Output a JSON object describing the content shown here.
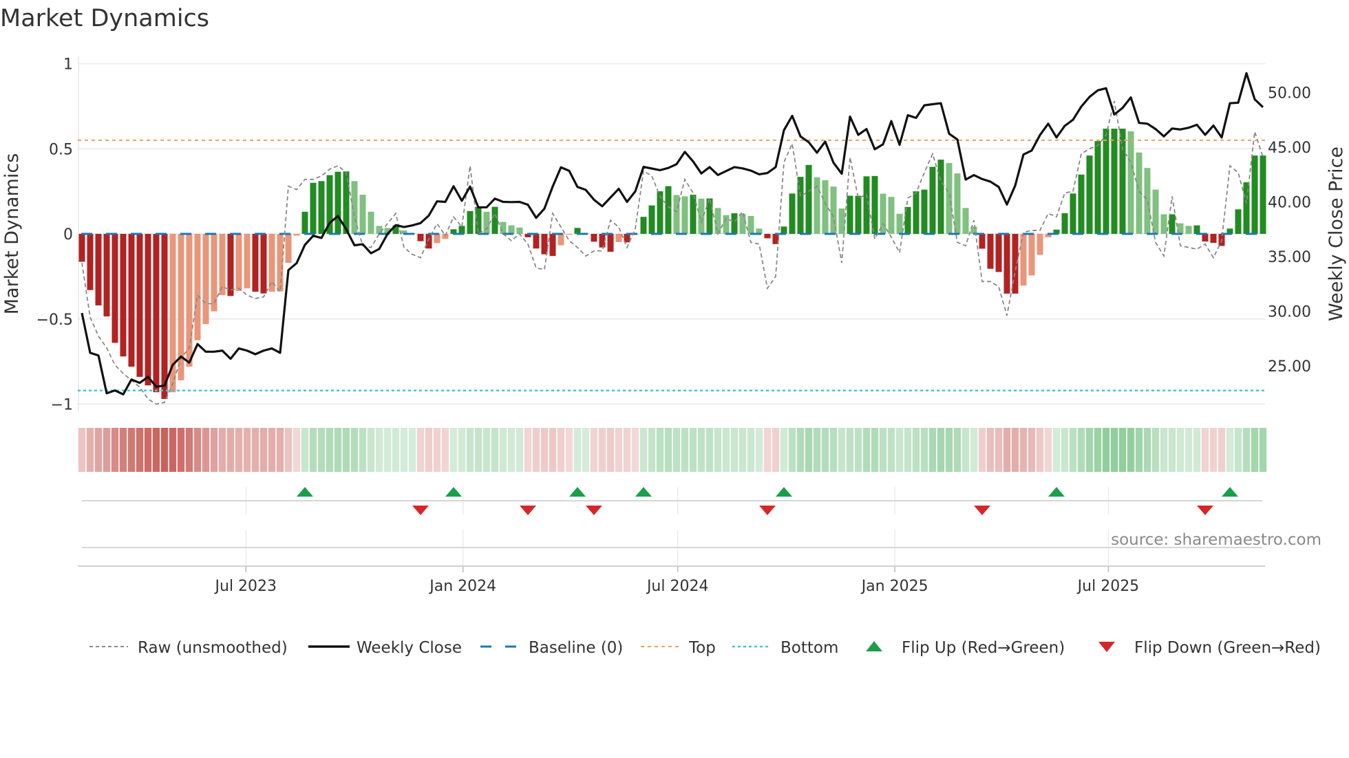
{
  "chart_data": {
    "type": "bar",
    "title": "Market Dynamics",
    "ylabel": "Market Dynamics",
    "y2label": "Weekly Close Price",
    "ylim": [
      -1.02,
      1.02
    ],
    "y2lim": [
      21.5,
      53.5
    ],
    "yticks": [
      {
        "v": 1,
        "label": "1"
      },
      {
        "v": 0.5,
        "label": "0.5"
      },
      {
        "v": 0,
        "label": "0"
      },
      {
        "v": -0.5,
        "label": "−0.5"
      },
      {
        "v": -1,
        "label": "−1"
      }
    ],
    "y2ticks": [
      {
        "v": 50,
        "label": "50.00"
      },
      {
        "v": 45,
        "label": "45.00"
      },
      {
        "v": 40,
        "label": "40.00"
      },
      {
        "v": 35,
        "label": "35.00"
      },
      {
        "v": 30,
        "label": "30.00"
      },
      {
        "v": 25,
        "label": "25.00"
      }
    ],
    "x_start": "2023-02-12",
    "x_step_days": 7,
    "xticks": [
      {
        "date": "2023-07-01",
        "label": "Jul 2023"
      },
      {
        "date": "2024-01-01",
        "label": "Jan 2024"
      },
      {
        "date": "2024-07-01",
        "label": "Jul 2024"
      },
      {
        "date": "2025-01-01",
        "label": "Jan 2025"
      },
      {
        "date": "2025-07-01",
        "label": "Jul 2025"
      }
    ],
    "top_level": 0.55,
    "bottom_level": -0.92,
    "baseline": 0,
    "momentum": [
      -0.164,
      -0.33,
      -0.42,
      -0.485,
      -0.64,
      -0.72,
      -0.78,
      -0.84,
      -0.89,
      -0.93,
      -0.97,
      -0.93,
      -0.86,
      -0.78,
      -0.625,
      -0.53,
      -0.455,
      -0.36,
      -0.365,
      -0.335,
      -0.32,
      -0.34,
      -0.35,
      -0.34,
      -0.338,
      -0.17,
      -0.01,
      0.13,
      0.3,
      0.31,
      0.345,
      0.365,
      0.367,
      0.31,
      0.23,
      0.13,
      0.047,
      0.035,
      0.05,
      0.02,
      0.005,
      -0.043,
      -0.086,
      -0.054,
      -0.03,
      0.027,
      0.047,
      0.134,
      0.159,
      0.13,
      0.159,
      0.07,
      0.05,
      0.037,
      -0.02,
      -0.086,
      -0.12,
      -0.13,
      -0.067,
      -0.005,
      0.035,
      0.003,
      -0.046,
      -0.08,
      -0.105,
      -0.048,
      -0.05,
      -0.004,
      0.1,
      0.167,
      0.25,
      0.28,
      0.228,
      0.22,
      0.23,
      0.207,
      0.208,
      0.152,
      0.11,
      0.121,
      0.118,
      0.105,
      0.031,
      -0.026,
      -0.06,
      0.043,
      0.237,
      0.335,
      0.405,
      0.332,
      0.315,
      0.278,
      0.149,
      0.224,
      0.224,
      0.338,
      0.34,
      0.236,
      0.217,
      0.118,
      0.158,
      0.25,
      0.26,
      0.394,
      0.436,
      0.416,
      0.355,
      0.152,
      0.043,
      -0.087,
      -0.205,
      -0.224,
      -0.351,
      -0.351,
      -0.304,
      -0.244,
      -0.123,
      -0.02,
      0.025,
      0.121,
      0.237,
      0.348,
      0.46,
      0.545,
      0.618,
      0.618,
      0.618,
      0.602,
      0.478,
      0.387,
      0.26,
      0.115,
      0.115,
      0.062,
      0.047,
      0.05,
      -0.045,
      -0.053,
      -0.071,
      0.031,
      0.144,
      0.303,
      0.46,
      0.46
    ],
    "raw": [
      -0.17,
      -0.49,
      -0.6,
      -0.67,
      -0.77,
      -0.82,
      -0.86,
      -0.9,
      -0.97,
      -1.0,
      -0.99,
      -0.88,
      -0.73,
      -0.67,
      -0.36,
      -0.41,
      -0.41,
      -0.31,
      -0.33,
      -0.32,
      -0.36,
      -0.38,
      -0.37,
      -0.28,
      -0.34,
      0.28,
      0.26,
      0.32,
      0.32,
      0.34,
      0.38,
      0.4,
      0.36,
      0.1,
      -0.07,
      -0.08,
      0.0,
      0.06,
      0.12,
      -0.08,
      -0.12,
      -0.14,
      -0.03,
      0.06,
      -0.01,
      0.1,
      0.04,
      0.4,
      0.0,
      0.03,
      0.12,
      0.0,
      -0.04,
      0.0,
      -0.06,
      -0.2,
      -0.21,
      0.12,
      0.04,
      -0.04,
      -0.08,
      -0.13,
      -0.1,
      -0.1,
      0.08,
      0.04,
      -0.08,
      0.03,
      0.37,
      0.34,
      0.22,
      0.16,
      0.13,
      0.32,
      0.24,
      0.07,
      0.21,
      0.0,
      0.09,
      0.07,
      0.13,
      -0.05,
      -0.06,
      -0.32,
      -0.25,
      0.42,
      0.53,
      0.22,
      0.25,
      0.28,
      0.18,
      0.1,
      -0.17,
      0.45,
      0.21,
      0.23,
      -0.03,
      0.06,
      -0.02,
      -0.11,
      0.21,
      0.24,
      0.36,
      0.47,
      0.31,
      0.24,
      -0.05,
      -0.07,
      0.08,
      -0.28,
      -0.28,
      -0.31,
      -0.48,
      -0.22,
      0.01,
      0.02,
      0.02,
      0.12,
      0.1,
      0.24,
      0.25,
      0.47,
      0.5,
      0.52,
      0.58,
      0.78,
      0.5,
      0.42,
      0.25,
      0.2,
      -0.05,
      -0.13,
      0.22,
      -0.07,
      -0.08,
      -0.09,
      -0.06,
      -0.14,
      -0.04,
      0.4,
      0.36,
      0.18,
      0.6,
      0.45
    ],
    "weekly_close": [
      29.84,
      26.2,
      25.96,
      22.5,
      22.76,
      22.4,
      23.76,
      23.45,
      24.0,
      23.1,
      23.2,
      25.1,
      25.86,
      25.3,
      27.0,
      26.3,
      26.3,
      26.4,
      25.65,
      26.6,
      26.4,
      26.07,
      26.4,
      26.6,
      26.2,
      33.76,
      34.4,
      36.07,
      36.9,
      36.7,
      38.08,
      38.7,
      37.5,
      36.03,
      36.13,
      35.3,
      35.7,
      37.07,
      37.87,
      37.7,
      37.85,
      38.06,
      38.75,
      40.05,
      40.0,
      41.43,
      40.1,
      41.4,
      39.5,
      39.5,
      40.3,
      40.0,
      39.98,
      40.0,
      39.74,
      38.54,
      39.38,
      41.4,
      43.16,
      42.84,
      41.37,
      41.1,
      40.2,
      39.6,
      40.4,
      41.2,
      40.0,
      40.96,
      43.2,
      43.05,
      42.9,
      43.1,
      43.45,
      44.57,
      43.7,
      42.6,
      43.18,
      42.46,
      42.82,
      43.18,
      43.06,
      42.86,
      42.52,
      42.64,
      43.18,
      46.55,
      47.87,
      45.99,
      45.46,
      44.5,
      45.51,
      43.58,
      42.57,
      47.8,
      46.13,
      46.66,
      44.81,
      45.27,
      47.39,
      45.22,
      47.92,
      47.68,
      48.83,
      48.93,
      49.02,
      46.23,
      45.7,
      42.04,
      42.45,
      42.09,
      41.85,
      41.37,
      39.76,
      41.49,
      44.33,
      44.7,
      46.11,
      47.15,
      45.89,
      46.95,
      47.51,
      48.71,
      49.6,
      50.2,
      50.39,
      47.99,
      48.59,
      49.55,
      47.22,
      47.15,
      46.66,
      45.99,
      46.71,
      46.62,
      46.78,
      47.05,
      46.13,
      46.98,
      45.89,
      49.02,
      49.07,
      51.77,
      49.38,
      48.66
    ],
    "flip_up_weeks": [
      28,
      46,
      61,
      69,
      86,
      119,
      140
    ],
    "flip_down_weeks": [
      42,
      55,
      63,
      84,
      110,
      137
    ],
    "legend": {
      "placement": "bottom",
      "items": [
        {
          "key": "raw",
          "label": "Raw (unsmoothed)"
        },
        {
          "key": "close",
          "label": "Weekly Close"
        },
        {
          "key": "baseline",
          "label": "Baseline (0)"
        },
        {
          "key": "top",
          "label": "Top"
        },
        {
          "key": "bottom",
          "label": "Bottom"
        },
        {
          "key": "up",
          "label": "Flip Up (Red→Green)"
        },
        {
          "key": "down",
          "label": "Flip Down (Green→Red)"
        }
      ]
    },
    "source": "source: sharemaestro.com"
  },
  "colors": {
    "neg_strong": "#b22222",
    "neg_weak": "#e9967a",
    "pos_strong": "#228b22",
    "pos_weak": "#80c080",
    "raw": "#888888",
    "close": "#111111",
    "baseline": "#1f77b4",
    "top": "#f0a060",
    "bottom": "#40c8d8",
    "flip_up": "#1a9e4a",
    "flip_down": "#d62728"
  }
}
